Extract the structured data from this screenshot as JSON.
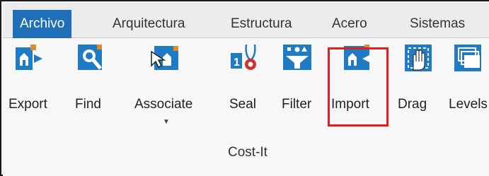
{
  "tabs": [
    {
      "label": "Archivo",
      "active": true
    },
    {
      "label": "Arquitectura",
      "active": false
    },
    {
      "label": "Estructura",
      "active": false
    },
    {
      "label": "Acero",
      "active": false
    },
    {
      "label": "Sistemas",
      "active": false
    }
  ],
  "tools": [
    {
      "label": "Export",
      "icon": "export-icon"
    },
    {
      "label": "Find",
      "icon": "find-icon"
    },
    {
      "label": "Associate",
      "icon": "associate-icon",
      "has_dropdown": true
    },
    {
      "label": "Seal",
      "icon": "seal-icon"
    },
    {
      "label": "Filter",
      "icon": "filter-icon"
    },
    {
      "label": "Import",
      "icon": "import-icon",
      "highlighted": true
    },
    {
      "label": "Drag",
      "icon": "drag-icon"
    },
    {
      "label": "Levels",
      "icon": "levels-icon"
    }
  ],
  "group_label": "Cost-It",
  "colors": {
    "active_tab": "#1e6fb8",
    "icon_blue": "#1f7cc4",
    "highlight": "#e02020"
  }
}
